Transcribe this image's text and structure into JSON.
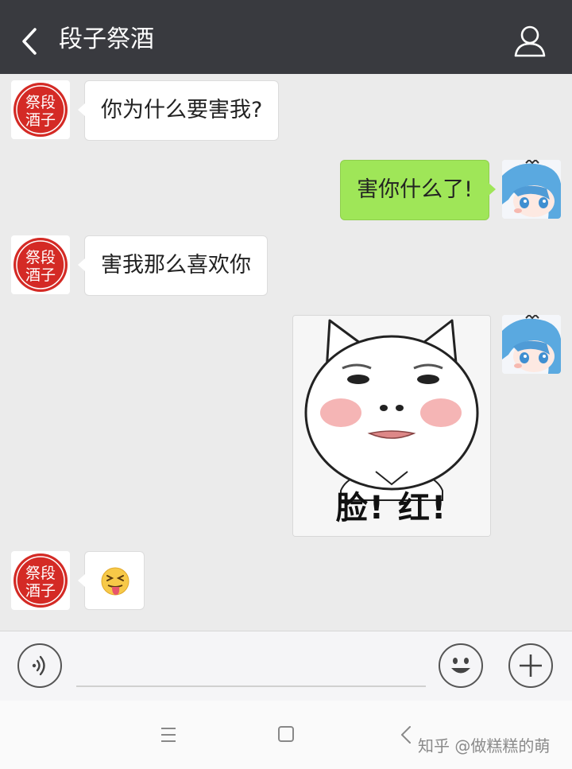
{
  "header": {
    "title": "段子祭酒"
  },
  "avatars": {
    "contact_stamp_line1": "祭段",
    "contact_stamp_line2": "酒子"
  },
  "messages": [
    {
      "side": "in",
      "text": "你为什么要害我?"
    },
    {
      "side": "out",
      "text": "害你什么了!"
    },
    {
      "side": "in",
      "text": "害我那么喜欢你"
    },
    {
      "side": "out",
      "type": "sticker",
      "caption": "脸! 红!"
    },
    {
      "side": "in",
      "type": "emoji",
      "emoji": "😝"
    }
  ],
  "input": {
    "placeholder": ""
  },
  "icons": {
    "back": "chevron-left-icon",
    "profile": "person-icon",
    "voice": "voice-icon",
    "emoji": "smiley-icon",
    "more": "plus-icon",
    "nav_menu": "menu-icon",
    "nav_home": "square-icon",
    "nav_back": "back-icon"
  },
  "watermark": "知乎 @做糕糕的萌",
  "colors": {
    "header_bg": "#393a3f",
    "chat_bg": "#ebebeb",
    "outgoing_bubble": "#9fe658",
    "incoming_bubble": "#ffffff",
    "stamp_red": "#d42a25"
  }
}
